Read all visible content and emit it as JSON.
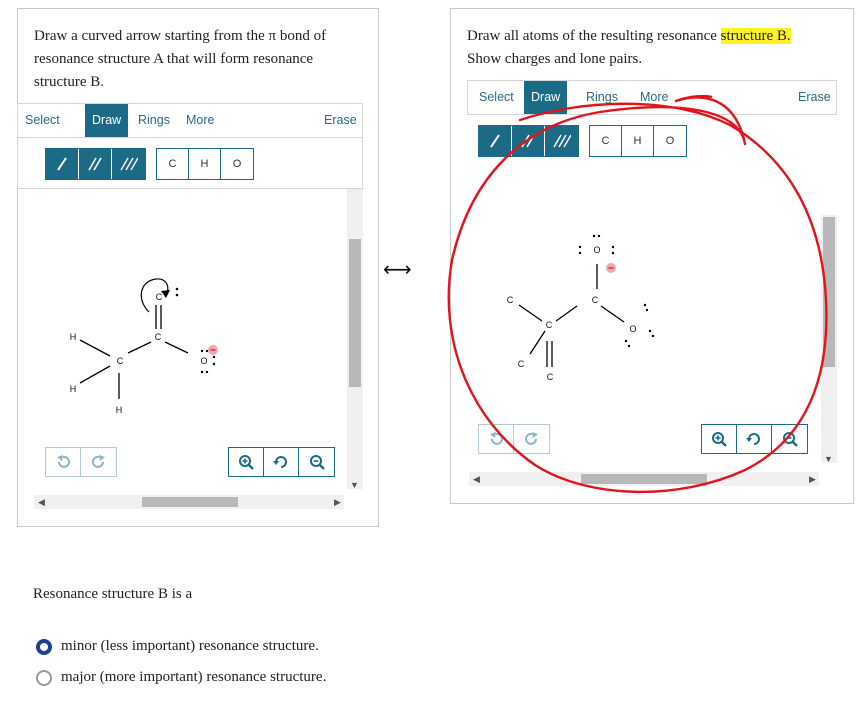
{
  "left_panel": {
    "prompt_lines": [
      "Draw a curved arrow starting from the π bond of",
      "resonance structure A that will form resonance",
      "structure B."
    ],
    "tabs": [
      "Select",
      "Draw",
      "Rings",
      "More"
    ],
    "active_tab": "Draw",
    "erase_label": "Erase",
    "elements": [
      "C",
      "H",
      "O"
    ],
    "atoms": {
      "h1": "H",
      "h2": "H",
      "h3": "H",
      "c1": "C",
      "c2": "C",
      "c3": "C",
      "o1": "O"
    }
  },
  "exchange_arrow": "⟷",
  "right_panel": {
    "prompt_line1_pre": "Draw all atoms of the resulting resonance ",
    "prompt_line1_highlight": "structure B.",
    "prompt_line2": "Show charges and lone pairs.",
    "tabs": [
      "Select",
      "Draw",
      "Rings",
      "More"
    ],
    "active_tab": "Draw",
    "erase_label": "Erase",
    "elements": [
      "C",
      "H",
      "O"
    ],
    "atoms": {
      "o_top": "O",
      "c_left": "C",
      "c_mid": "C",
      "c_right": "C",
      "c_low": "C",
      "c_bottom": "C",
      "o_right": "O"
    }
  },
  "question": {
    "text": "Resonance structure B is a",
    "options": [
      {
        "label": "minor (less important) resonance structure.",
        "selected": true
      },
      {
        "label": "major (more important) resonance structure.",
        "selected": false
      }
    ]
  },
  "colors": {
    "accent": "#1c6b86",
    "annotation_red": "#e3131b",
    "highlight": "#fdf12a",
    "radio_selected": "#1c3f94",
    "charge_pink": "#f4a6b0"
  },
  "icons": [
    "single-bond-icon",
    "double-bond-icon",
    "triple-bond-icon",
    "undo-icon",
    "redo-icon",
    "zoom-in-icon",
    "reset-zoom-icon",
    "zoom-out-icon"
  ]
}
